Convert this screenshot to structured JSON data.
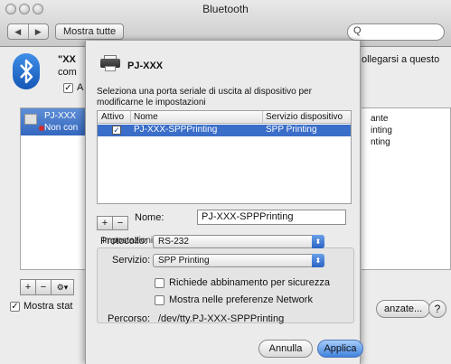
{
  "window": {
    "title": "Bluetooth",
    "show_all": "Mostra tutte",
    "back_glyph": "◀",
    "forward_glyph": "▶",
    "search_glyph": "Q"
  },
  "background": {
    "device_intro": "\"XX",
    "device_intro_2": "com",
    "right_text": "ollegarsi a questo",
    "check_label": "A",
    "device_name": "PJ-XXX",
    "device_status": "Non con",
    "service_lines": [
      "ante",
      "inting",
      "nting"
    ],
    "mostra_stato": "Mostra stat",
    "advanced": "anzate...",
    "help": "?"
  },
  "sheet": {
    "title": "PJ-XXX",
    "instruction": "Seleziona una porta seriale di uscita al dispositivo per modificarne le impostazioni",
    "table": {
      "headers": [
        "Attivo",
        "Nome",
        "Servizio dispositivo"
      ],
      "rows": [
        {
          "active": true,
          "name": "PJ-XXX-SPPPrinting",
          "service": "SPP Printing"
        }
      ]
    },
    "add": "+",
    "remove": "−",
    "port_settings_label": "Impostazioni porta:",
    "name_label": "Nome:",
    "name_value": "PJ-XXX-SPPPrinting",
    "protocol_label": "Protocollo:",
    "protocol_value": "RS-232",
    "service_label": "Servizio:",
    "service_value": "SPP Printing",
    "pairing_label": "Richiede abbinamento per sicurezza",
    "network_label": "Mostra nelle preferenze Network",
    "path_label": "Percorso:",
    "path_value": "/dev/tty.PJ-XXX-SPPPrinting",
    "cancel": "Annulla",
    "apply": "Applica"
  }
}
